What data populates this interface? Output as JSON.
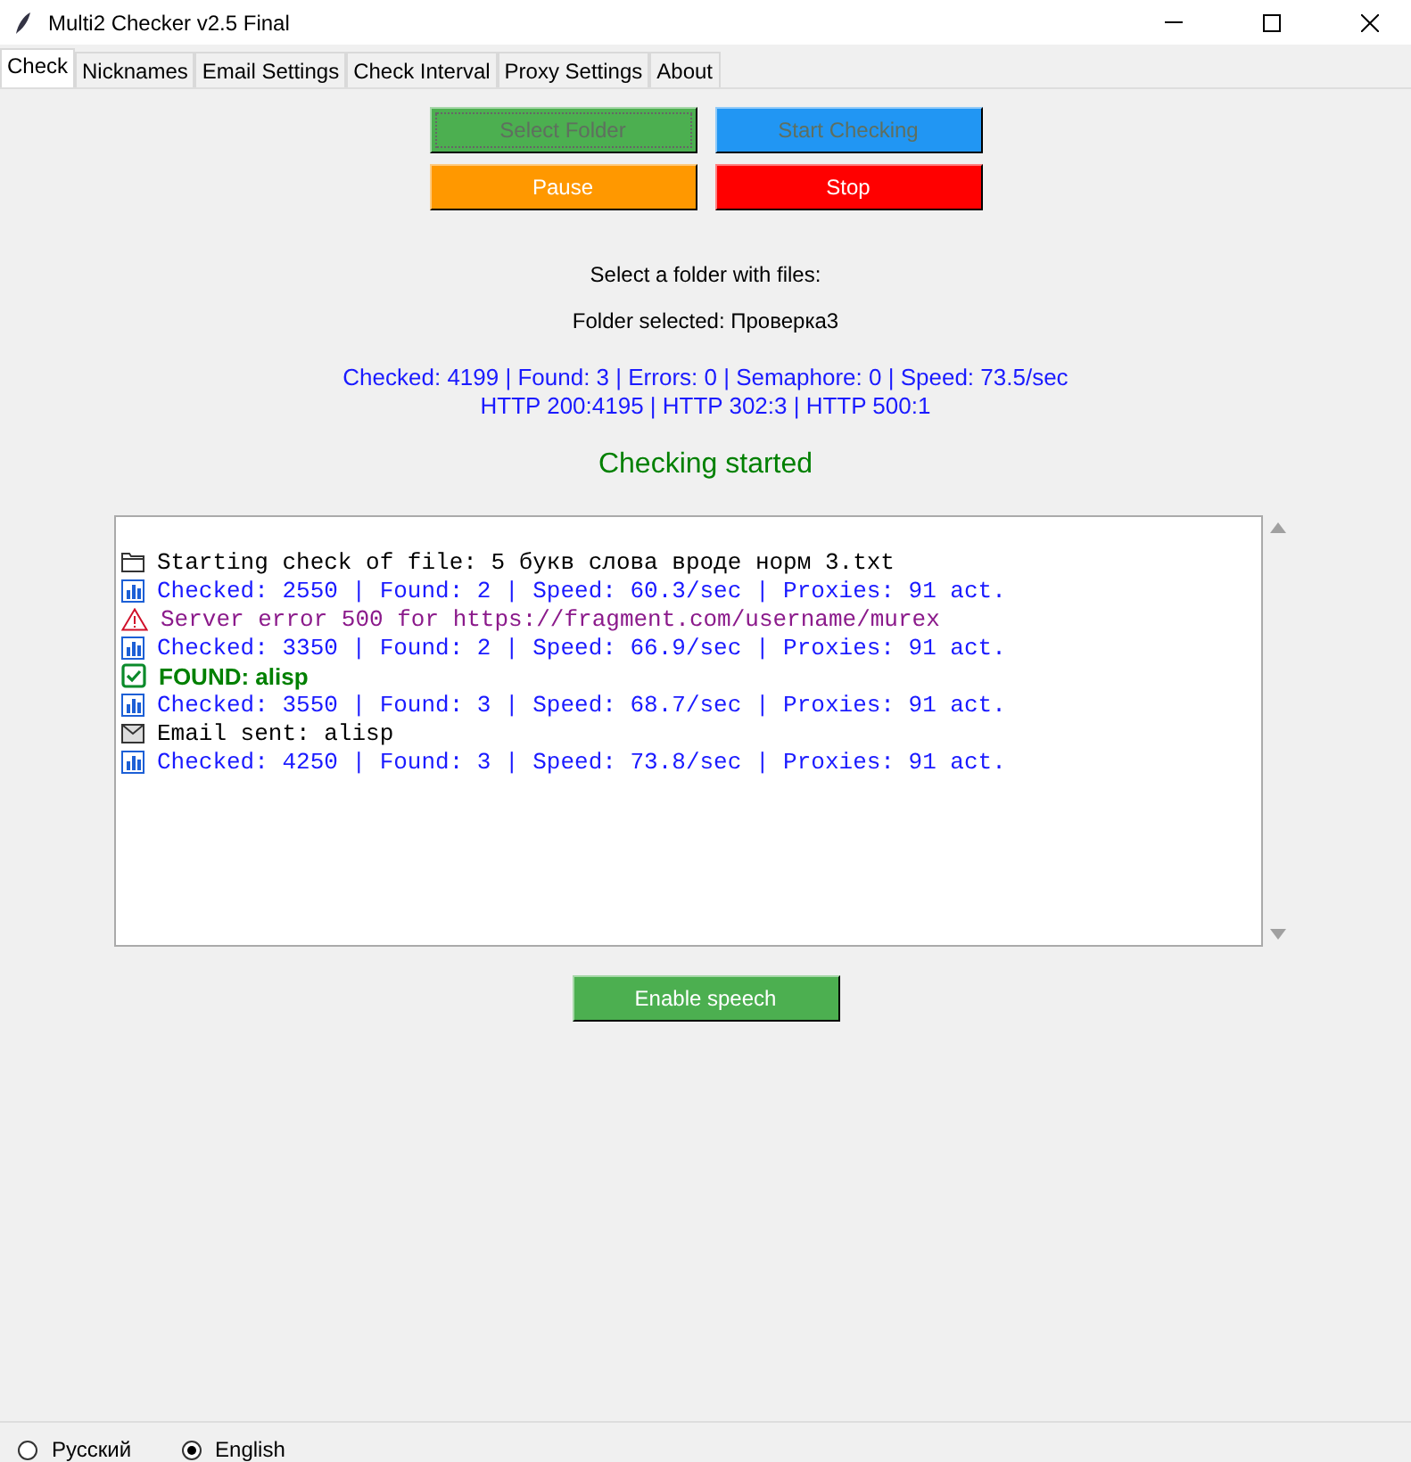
{
  "window": {
    "title": "Multi2 Checker v2.5 Final"
  },
  "tabs": [
    {
      "label": "Check",
      "selected": true
    },
    {
      "label": "Nicknames",
      "selected": false
    },
    {
      "label": "Email Settings",
      "selected": false
    },
    {
      "label": "Check Interval",
      "selected": false
    },
    {
      "label": "Proxy Settings",
      "selected": false
    },
    {
      "label": "About",
      "selected": false
    }
  ],
  "buttons": [
    {
      "label": "Select Folder",
      "color": "#4caf50",
      "disabled": true,
      "focused": true
    },
    {
      "label": "Start Checking",
      "color": "#2196f3",
      "disabled": true,
      "focused": false
    },
    {
      "label": "Pause",
      "color": "#ff9800",
      "disabled": false,
      "focused": false
    },
    {
      "label": "Stop",
      "color": "#ff0000",
      "disabled": false,
      "focused": false
    }
  ],
  "prompt": "Select a folder with files:",
  "folder": "Folder selected: Проверка3",
  "stats": [
    "Checked: 4199 | Found: 3 | Errors: 0 | Semaphore: 0 | Speed: 73.5/sec",
    "HTTP 200:4195 | HTTP 302:3 | HTTP 500:1"
  ],
  "status": "Checking started",
  "log": [
    {
      "kind": "file",
      "text": "Starting check of file: 5 букв слова вроде норм 3.txt"
    },
    {
      "kind": "stats",
      "text": "Checked: 2550 | Found: 2 | Speed: 60.3/sec | Proxies: 91 act."
    },
    {
      "kind": "error",
      "text": "Server error 500 for https://fragment.com/username/murex"
    },
    {
      "kind": "stats",
      "text": "Checked: 3350 | Found: 2 | Speed: 66.9/sec | Proxies: 91 act."
    },
    {
      "kind": "found",
      "text": "FOUND: alisp"
    },
    {
      "kind": "stats",
      "text": "Checked: 3550 | Found: 3 | Speed: 68.7/sec | Proxies: 91 act."
    },
    {
      "kind": "email",
      "text": "Email sent: alisp"
    },
    {
      "kind": "stats",
      "text": "Checked: 4250 | Found: 3 | Speed: 73.8/sec | Proxies: 91 act."
    }
  ],
  "speech_button": {
    "label": "Enable speech",
    "color": "#4caf50"
  },
  "languages": [
    {
      "label": "Русский",
      "selected": false
    },
    {
      "label": "English",
      "selected": true
    }
  ]
}
